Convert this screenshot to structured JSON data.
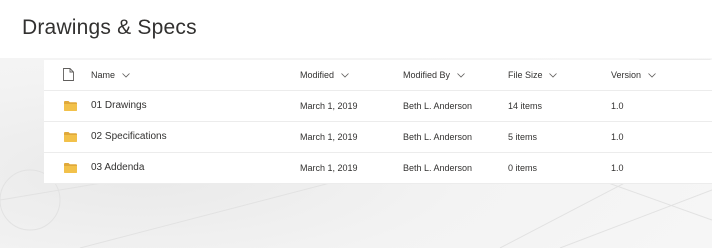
{
  "page": {
    "title": "Drawings & Specs"
  },
  "columns": {
    "name": "Name",
    "modified": "Modified",
    "modified_by": "Modified By",
    "file_size": "File Size",
    "version": "Version"
  },
  "rows": [
    {
      "name": "01 Drawings",
      "modified": "March 1, 2019",
      "modified_by": "Beth L. Anderson",
      "file_size": "14 items",
      "version": "1.0"
    },
    {
      "name": "02 Specifications",
      "modified": "March 1, 2019",
      "modified_by": "Beth L. Anderson",
      "file_size": "5 items",
      "version": "1.0"
    },
    {
      "name": "03 Addenda",
      "modified": "March 1, 2019",
      "modified_by": "Beth L. Anderson",
      "file_size": "0 items",
      "version": "1.0"
    }
  ],
  "colors": {
    "folder": "#f2c14a",
    "folder_back": "#e0a93a"
  }
}
